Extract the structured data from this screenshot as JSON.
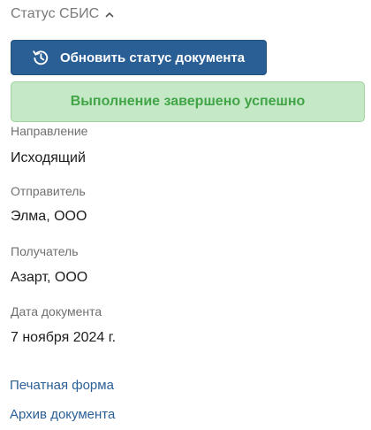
{
  "section": {
    "title": "Статус СБИС",
    "toggle_icon": "chevron-up-icon"
  },
  "refresh_button": {
    "label": "Обновить статус документа",
    "icon": "history-icon",
    "bg_color": "#2a5f96"
  },
  "status_banner": {
    "text": "Выполнение завершено успешно",
    "bg_color": "#c5e8c6",
    "text_color": "#41a548"
  },
  "fields": [
    {
      "label": "Направление",
      "value": "Исходящий"
    },
    {
      "label": "Отправитель",
      "value": "Элма, ООО"
    },
    {
      "label": "Получатель",
      "value": "Азарт, ООО"
    },
    {
      "label": "Дата документа",
      "value": "7 ноября 2024 г."
    }
  ],
  "links": [
    {
      "label": "Печатная форма"
    },
    {
      "label": "Архив документа"
    }
  ],
  "colors": {
    "accent": "#2a5f96",
    "success": "#41a548"
  }
}
